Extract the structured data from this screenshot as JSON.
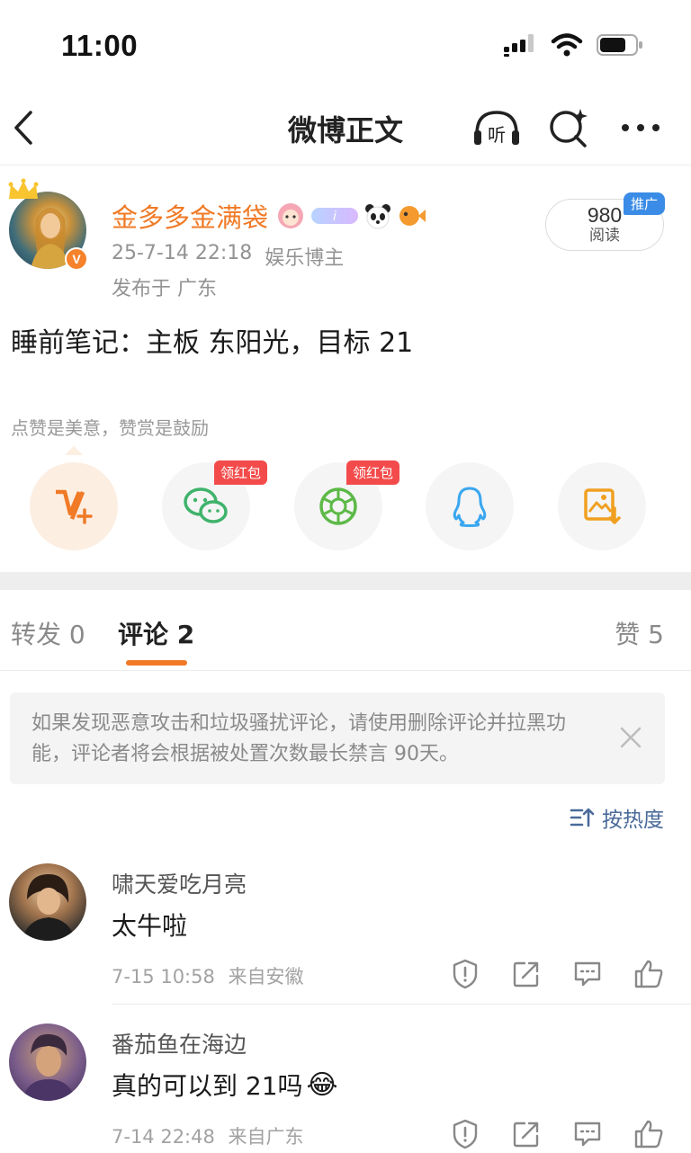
{
  "status": {
    "time": "11:00"
  },
  "nav": {
    "title": "微博正文",
    "listen_icon": "listen-icon",
    "search_icon": "search-sparkle-icon",
    "more_icon": "more-icon"
  },
  "author": {
    "name": "金多多金满袋",
    "timestamp": "25-7-14 22:18",
    "role": "娱乐博主",
    "location": "发布于 广东",
    "read_count": "980",
    "read_label": "阅读",
    "promo_tag": "推广",
    "verified_badge": "V"
  },
  "post": {
    "text": "睡前笔记：主板  东阳光，目标 21"
  },
  "reward": {
    "hint": "点赞是美意，赞赏是鼓励"
  },
  "share": {
    "buttons": [
      {
        "name": "reward",
        "icon": "reward-v-icon",
        "tag": ""
      },
      {
        "name": "wechat",
        "icon": "wechat-icon",
        "tag": "领红包"
      },
      {
        "name": "moments",
        "icon": "moments-icon",
        "tag": "领红包"
      },
      {
        "name": "qq",
        "icon": "qq-icon",
        "tag": ""
      },
      {
        "name": "save-image",
        "icon": "save-image-icon",
        "tag": ""
      }
    ],
    "accent": "#f07a26"
  },
  "tabs": {
    "repost": "转发 0",
    "comment": "评论 2",
    "like": "赞 5"
  },
  "notice": {
    "text": "如果发现恶意攻击和垃圾骚扰评论，请使用删除评论并拉黑功能，评论者将会根据被处置次数最长禁言 90天。"
  },
  "sort": {
    "label": "按热度"
  },
  "comments": [
    {
      "name": "啸天爱吃月亮",
      "text": "太牛啦",
      "time": "7-15 10:58",
      "source": "来自安徽"
    },
    {
      "name": "番茄鱼在海边",
      "text": "真的可以到 21吗",
      "time": "7-14 22:48",
      "source": "来自广东",
      "emoji": "😂"
    }
  ]
}
